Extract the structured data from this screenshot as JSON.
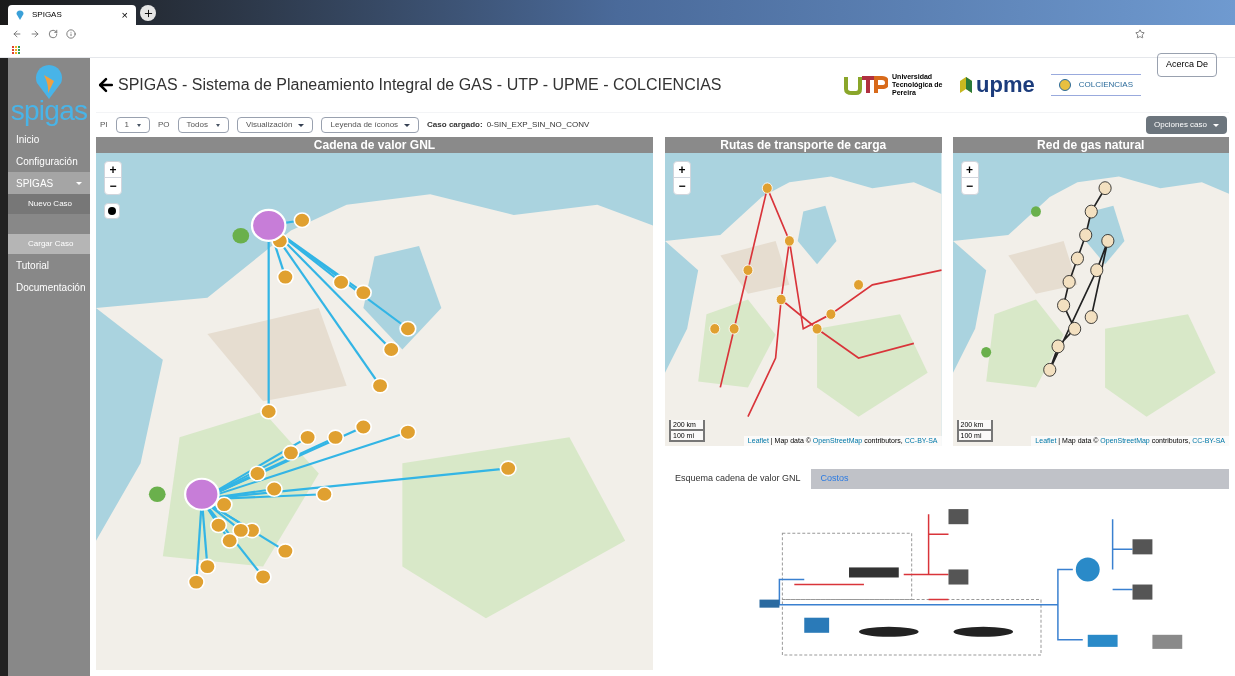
{
  "browser": {
    "tab_title": "SPIGAS",
    "tab_close": "×"
  },
  "header": {
    "logo_text": "spigas",
    "title": "SPIGAS - Sistema de Planeamiento Integral de GAS - UTP - UPME - COLCIENCIAS",
    "logos": [
      {
        "kind": "utp",
        "text": "Universidad Tecnológica de Pereira"
      },
      {
        "kind": "upme",
        "text": "upme"
      },
      {
        "kind": "colciencias",
        "text": "COLCIENCIAS"
      }
    ],
    "about_button": "Acerca De"
  },
  "sidebar": {
    "items": [
      {
        "label": "Inicio",
        "selected": false
      },
      {
        "label": "Configuración",
        "selected": false
      },
      {
        "label": "SPIGAS",
        "selected": true,
        "expanded": true,
        "children": [
          {
            "label": "Nuevo Caso",
            "selected": false
          },
          {
            "label": "Cargar Caso",
            "selected": true
          }
        ]
      },
      {
        "label": "Tutorial",
        "selected": false
      },
      {
        "label": "Documentación",
        "selected": false
      }
    ]
  },
  "toolbar": {
    "pi_label": "PI",
    "pi_value": "1",
    "po_label": "PO",
    "po_value": "Todos",
    "dropdowns": [
      "Visualización",
      "Leyenda de íconos"
    ],
    "loaded_label": "Caso cargado:",
    "loaded_value": "0-SIN_EXP_SIN_NO_CONV",
    "options_button": "Opciones caso"
  },
  "maps": [
    {
      "title": "Cadena de valor GNL",
      "kind": "gnl",
      "zoom_in": "+",
      "zoom_out": "−",
      "locate": true
    },
    {
      "title": "Rutas de transporte de carga",
      "kind": "routes",
      "zoom_in": "+",
      "zoom_out": "−",
      "scale": [
        "200 km",
        "100 mi"
      ],
      "attribution": [
        "Leaflet",
        " | Map data © ",
        "OpenStreetMap",
        " contributors, ",
        "CC-BY-SA"
      ]
    },
    {
      "title": "Red de gas natural",
      "kind": "network",
      "zoom_in": "+",
      "zoom_out": "−",
      "scale": [
        "200 km",
        "100 mi"
      ],
      "attribution": [
        "Leaflet",
        " | Map data © ",
        "OpenStreetMap",
        " contributors, ",
        "CC-BY-SA"
      ]
    }
  ],
  "tabs": [
    {
      "label": "Esquema cadena de valor GNL",
      "selected": true
    },
    {
      "label": "Costos",
      "selected": false
    }
  ]
}
